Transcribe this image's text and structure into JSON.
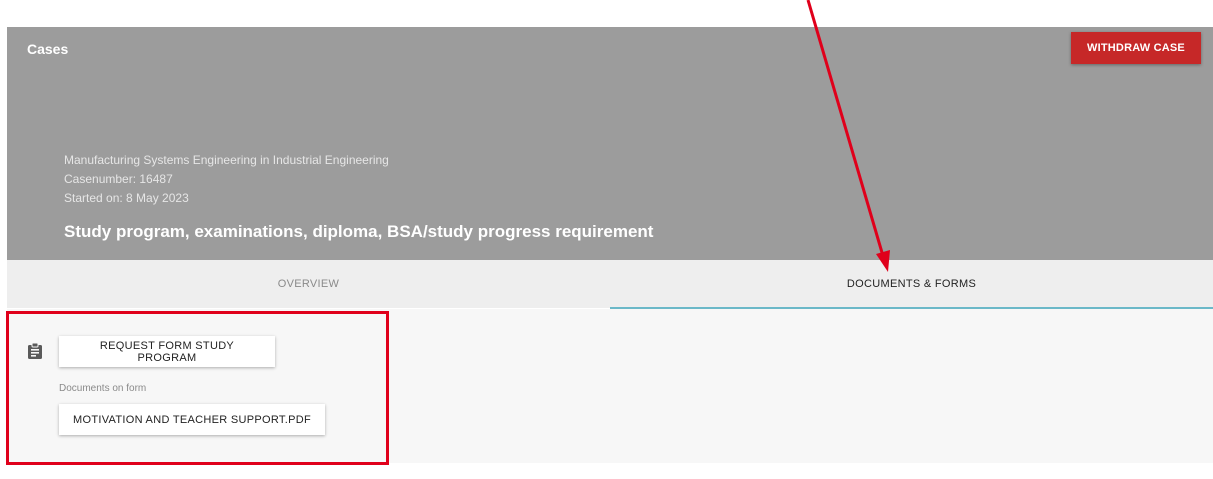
{
  "header": {
    "title": "Cases",
    "withdraw_label": "WITHDRAW CASE",
    "program": "Manufacturing Systems Engineering in Industrial Engineering",
    "case_number": "Casenumber: 16487",
    "started_on": "Started on: 8 May 2023",
    "subject": "Study program, examinations, diploma, BSA/study progress requirement"
  },
  "tabs": [
    {
      "label": "OVERVIEW",
      "active": false
    },
    {
      "label": "DOCUMENTS & FORMS",
      "active": true
    }
  ],
  "forms": {
    "icon": "clipboard-icon",
    "form_label": "REQUEST FORM STUDY PROGRAM",
    "documents_label": "Documents on form",
    "document_label": "MOTIVATION AND TEACHER SUPPORT.PDF"
  },
  "annotations": {
    "color": "#e0001b"
  },
  "colors": {
    "header_bg": "#9c9c9c",
    "withdraw_bg": "#c62828",
    "tab_indicator": "#6bb8c8"
  }
}
